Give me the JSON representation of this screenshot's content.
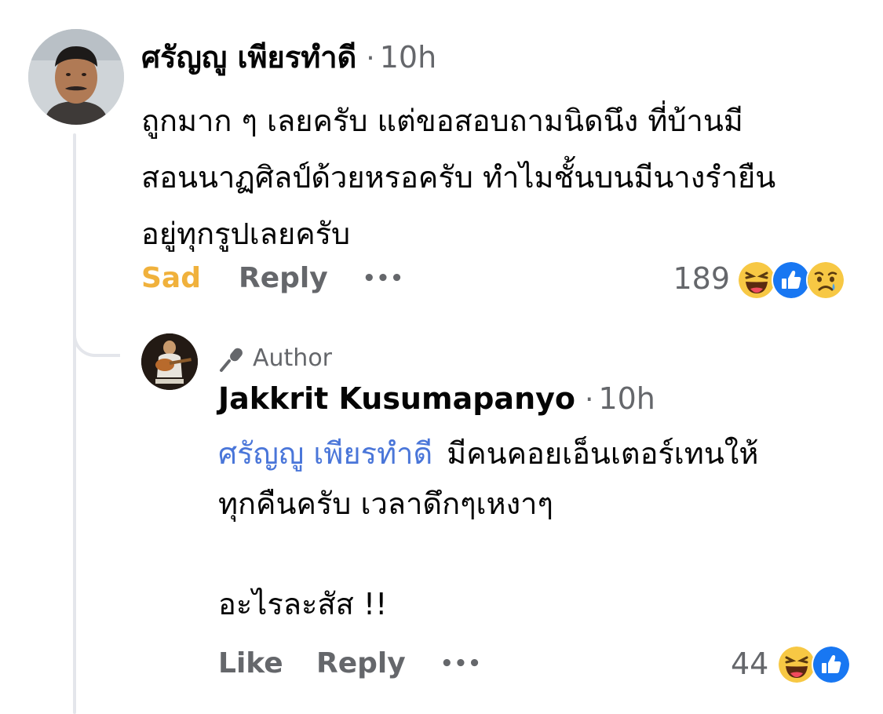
{
  "comment": {
    "author": "ศรัญญู เพียรทำดี",
    "separator": "·",
    "time": "10h",
    "lines": [
      "ถูกมาก ๆ เลยครับ แต่ขอสอบถามนิดนึง ที่บ้านมี",
      "สอนนาฏศิลป์ด้วยหรอครับ ทำไมชั้นบนมีนางรำยืน",
      "อยู่ทุกรูปเลยครับ"
    ],
    "actions": {
      "reaction_label": "Sad",
      "reply_label": "Reply",
      "more_label": "•••"
    },
    "reaction_count": "189",
    "reaction_icons": [
      "laughing-face-icon",
      "like-icon",
      "sad-face-icon"
    ]
  },
  "reply": {
    "badge": "Author",
    "badge_icon": "microphone-icon",
    "author": "Jakkrit Kusumapanyo",
    "separator": "·",
    "time": "10h",
    "mention": "ศรัญญู เพียรทำดี",
    "line1_rest": "มีคนคอยเอ็นเตอร์เทนให้",
    "line2": "ทุกคืนครับ เวลาดึกๆเหงาๆ",
    "line3": "อะไรละสัส !!",
    "actions": {
      "like_label": "Like",
      "reply_label": "Reply",
      "more_label": "•••"
    },
    "reaction_count": "44",
    "reaction_icons": [
      "laughing-face-icon",
      "like-icon"
    ]
  },
  "colors": {
    "sad": "#f0b13c",
    "mention": "#4a76d9",
    "muted": "#65676b",
    "like_blue": "#1877f2",
    "haha_yellow": "#f7c844"
  }
}
